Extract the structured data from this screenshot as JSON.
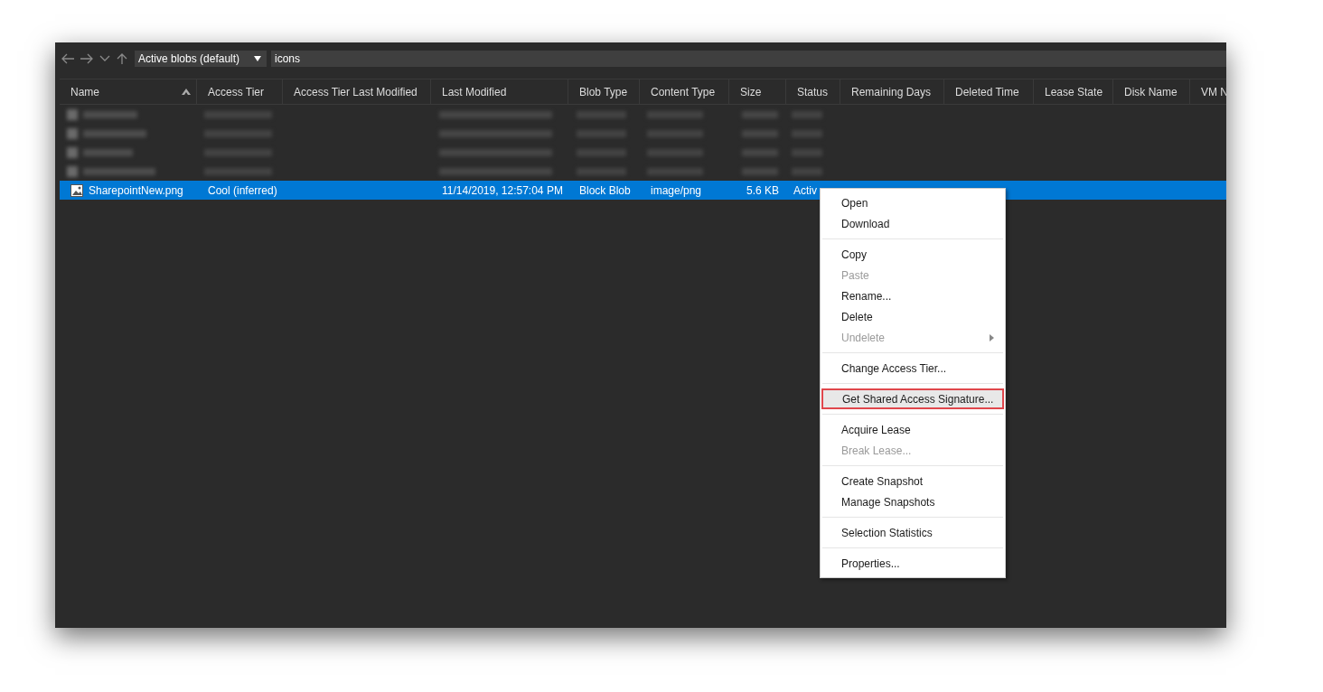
{
  "toolbar": {
    "filter": {
      "value": "Active blobs (default)"
    },
    "path": {
      "value": "icons"
    }
  },
  "table": {
    "columns": [
      {
        "label": "Name",
        "sorted": true
      },
      {
        "label": "Access Tier",
        "sorted": false
      },
      {
        "label": "Access Tier Last Modified",
        "sorted": false
      },
      {
        "label": "Last Modified",
        "sorted": false
      },
      {
        "label": "Blob Type",
        "sorted": false
      },
      {
        "label": "Content Type",
        "sorted": false
      },
      {
        "label": "Size",
        "sorted": false
      },
      {
        "label": "Status",
        "sorted": false
      },
      {
        "label": "Remaining Days",
        "sorted": false
      },
      {
        "label": "Deleted Time",
        "sorted": false
      },
      {
        "label": "Lease State",
        "sorted": false
      },
      {
        "label": "Disk Name",
        "sorted": false
      },
      {
        "label": "VM N"
      }
    ],
    "rows": [
      {
        "kind": "blurred",
        "selected": false
      },
      {
        "kind": "blurred",
        "selected": false
      },
      {
        "kind": "blurred",
        "selected": false
      },
      {
        "kind": "blurred",
        "selected": false
      },
      {
        "kind": "file",
        "selected": true,
        "cells": [
          "SharepointNew.png",
          "Cool (inferred)",
          "",
          "11/14/2019, 12:57:04 PM",
          "Block Blob",
          "image/png",
          "5.6 KB",
          "Activ"
        ]
      }
    ]
  },
  "context_menu": {
    "groups": [
      [
        {
          "label": "Open",
          "disabled": false,
          "selected": false,
          "submenu": false
        },
        {
          "label": "Download",
          "disabled": false,
          "selected": false,
          "submenu": false
        }
      ],
      [
        {
          "label": "Copy",
          "disabled": false,
          "selected": false,
          "submenu": false
        },
        {
          "label": "Paste",
          "disabled": true,
          "selected": false,
          "submenu": false
        },
        {
          "label": "Rename...",
          "disabled": false,
          "selected": false,
          "submenu": false
        },
        {
          "label": "Delete",
          "disabled": false,
          "selected": false,
          "submenu": false
        },
        {
          "label": "Undelete",
          "disabled": true,
          "selected": false,
          "submenu": true
        }
      ],
      [
        {
          "label": "Change Access Tier...",
          "disabled": false,
          "selected": false,
          "submenu": false
        }
      ],
      [
        {
          "label": "Get Shared Access Signature...",
          "disabled": false,
          "selected": true,
          "submenu": false
        }
      ],
      [
        {
          "label": "Acquire Lease",
          "disabled": false,
          "selected": false,
          "submenu": false
        },
        {
          "label": "Break Lease...",
          "disabled": true,
          "selected": false,
          "submenu": false
        }
      ],
      [
        {
          "label": "Create Snapshot",
          "disabled": false,
          "selected": false,
          "submenu": false
        },
        {
          "label": "Manage Snapshots",
          "disabled": false,
          "selected": false,
          "submenu": false
        }
      ],
      [
        {
          "label": "Selection Statistics",
          "disabled": false,
          "selected": false,
          "submenu": false
        }
      ],
      [
        {
          "label": "Properties...",
          "disabled": false,
          "selected": false,
          "submenu": false
        }
      ]
    ]
  }
}
